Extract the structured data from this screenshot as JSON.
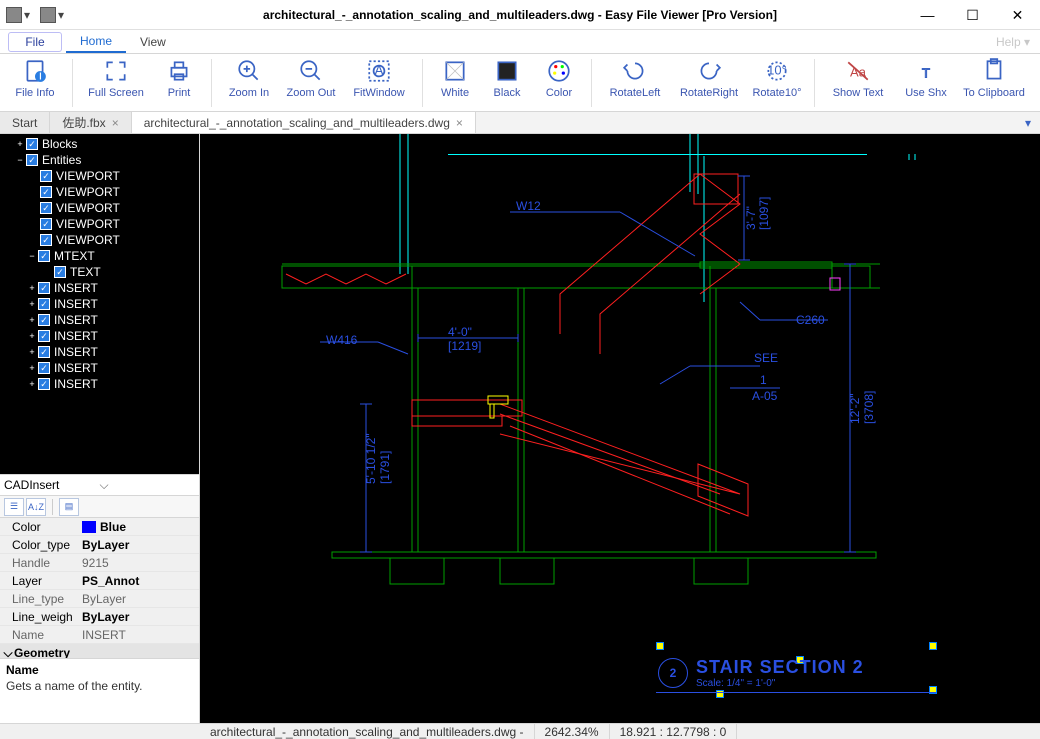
{
  "window": {
    "title": "architectural_-_annotation_scaling_and_multileaders.dwg - Easy File Viewer [Pro Version]",
    "min_icon": "—",
    "max_icon": "☐",
    "close_icon": "✕"
  },
  "menu": {
    "file": "File",
    "tabs": [
      "Home",
      "View"
    ],
    "active_tab": 0,
    "help": "Help ▾"
  },
  "ribbon": {
    "file_info": "File Info",
    "full_screen": "Full Screen",
    "print": "Print",
    "zoom_in": "Zoom In",
    "zoom_out": "Zoom Out",
    "fit_window": "FitWindow",
    "white": "White",
    "black": "Black",
    "color": "Color",
    "rotate_left": "RotateLeft",
    "rotate_right": "RotateRight",
    "rotate_10": "Rotate10°",
    "show_text": "Show Text",
    "use_shx": "Use Shx",
    "to_clipboard": "To Clipboard"
  },
  "doc_tabs": {
    "items": [
      "Start",
      "佐助.fbx",
      "architectural_-_annotation_scaling_and_multileaders.dwg"
    ],
    "active": 2
  },
  "tree": {
    "blocks": "Blocks",
    "entities": "Entities",
    "viewport": "VIEWPORT",
    "mtext": "MTEXT",
    "text": "TEXT",
    "insert": "INSERT"
  },
  "cad_select": {
    "label": "CADInsert"
  },
  "prop_toolbar": {
    "cat": "☰",
    "az": "A↓Z",
    "pages": "▤"
  },
  "props": [
    {
      "k": "Color",
      "v": "Blue",
      "bold": true,
      "swatch": "#0000ff"
    },
    {
      "k": "Color_type",
      "v": "ByLayer",
      "bold": true
    },
    {
      "k": "Handle",
      "v": "9215",
      "bold": false
    },
    {
      "k": "Layer",
      "v": "PS_Annot",
      "bold": true
    },
    {
      "k": "Line_type",
      "v": "ByLayer",
      "bold": false
    },
    {
      "k": "Line_weight",
      "v": "ByLayer",
      "bold": true,
      "trunc": "Line_weigh"
    },
    {
      "k": "Name",
      "v": "INSERT",
      "bold": false
    }
  ],
  "prop_group": "Geometry",
  "desc": {
    "title": "Name",
    "body": "Gets a name of the entity."
  },
  "drawing": {
    "labels": {
      "w12": "W12",
      "w416": "W416",
      "four_ft": "4'-0\"",
      "mm1219": "[1219]",
      "mm1097": "[1097]",
      "dim_3_7": "3'-7\"",
      "c260": "C260",
      "see": "SEE",
      "one": "1",
      "a05": "A-05",
      "dim_5_10": "5'-10 1/2\"",
      "mm1791": "[1791]",
      "dim_12": "12'-2\"",
      "mm3708": "[3708]",
      "bubble_num": "2",
      "title": "STAIR SECTION 2",
      "scale": "Scale: 1/4\" = 1'-0\""
    }
  },
  "status": {
    "file": "architectural_-_annotation_scaling_and_multileaders.dwg -",
    "zoom": "2642.34%",
    "coords": "18.921 : 12.7798 : 0"
  }
}
